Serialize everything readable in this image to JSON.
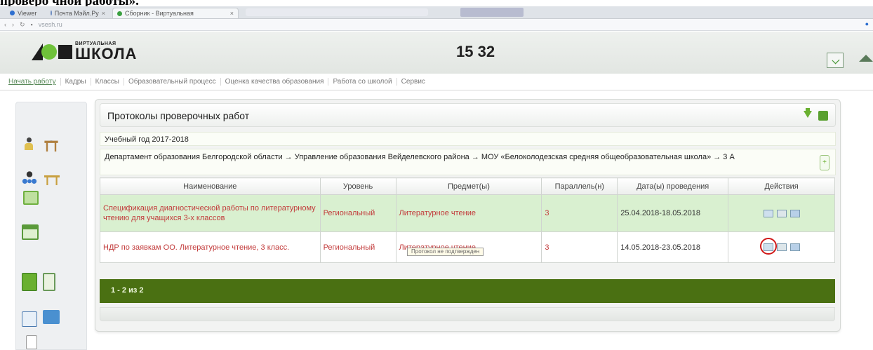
{
  "document": {
    "caption": "проверо чной работы»."
  },
  "browser": {
    "tabs": [
      {
        "label": "Viewer",
        "color": "#2d6fd0"
      },
      {
        "label": "Почта Мэйл.Ру",
        "color": "#6a8ac0"
      },
      {
        "label": "Сборник - Виртуальная",
        "color": "#3aa040"
      }
    ],
    "address": "vsesh.ru",
    "close_glyph": "×"
  },
  "header": {
    "logo_top": "ВИРТУАЛЬНАЯ",
    "logo_bottom": "ШКОЛА",
    "clock": "15 32"
  },
  "nav": {
    "items": [
      "Начать работу",
      "Кадры",
      "Классы",
      "Образовательный процесс",
      "Оценка качества образования",
      "Работа со школой",
      "Сервис"
    ]
  },
  "panel": {
    "title": "Протоколы проверочных работ",
    "year": "Учебный год 2017-2018",
    "breadcrumb": "Департамент образования Белгородской области → Управление образования Вейделевского района → МОУ «Белоколодезская средняя общеобразовательная школа» → 3 А",
    "expand_glyph": "+"
  },
  "table": {
    "headers": [
      "Наименование",
      "Уровень",
      "Предмет(ы)",
      "Параллель(н)",
      "Дата(ы) проведения",
      "Действия"
    ],
    "rows": [
      {
        "name": "Спецификация диагностической работы по литературному чтению для учащихся 3-х классов",
        "level": "Региональный",
        "subject": "Литературное чтение",
        "parallel": "3",
        "dates": "25.04.2018-18.05.2018"
      },
      {
        "name": "НДР по заявкам ОО. Литературное чтение, 3 класс.",
        "level": "Региональный",
        "subject": "Литературное чтение",
        "parallel": "3",
        "dates": "14.05.2018-23.05.2018"
      }
    ],
    "tooltip": "Протокол не подтвержден",
    "pager": "1 - 2 из 2"
  },
  "colors": {
    "accent_green": "#6ab030",
    "pager_green": "#4a7012",
    "row_highlight": "#d9f0d0",
    "link_red": "#c23a3a",
    "annotation_ring": "#d01818"
  }
}
